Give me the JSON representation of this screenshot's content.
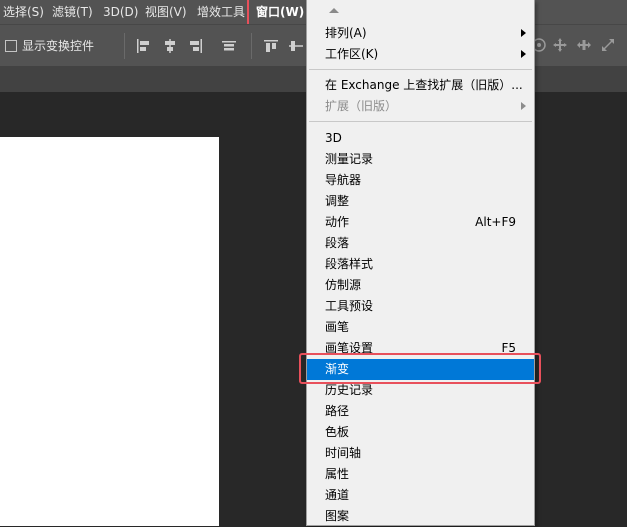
{
  "menubar": {
    "items": [
      {
        "label": "选择(S)"
      },
      {
        "label": "滤镜(T)"
      },
      {
        "label": "3D(D)"
      },
      {
        "label": "视图(V)"
      },
      {
        "label": "增效工具"
      },
      {
        "label": "窗口(W)"
      }
    ]
  },
  "optionsbar": {
    "show_transform_label": "显示变换控件",
    "show_transform_checked": false
  },
  "window_menu": {
    "items": [
      {
        "label": "排列(A)",
        "submenu": true
      },
      {
        "label": "工作区(K)",
        "submenu": true
      },
      {
        "label": "在 Exchange 上查找扩展（旧版）..."
      },
      {
        "label": "扩展（旧版）",
        "submenu": true,
        "disabled": true
      },
      {
        "label": "3D"
      },
      {
        "label": "测量记录"
      },
      {
        "label": "导航器"
      },
      {
        "label": "调整"
      },
      {
        "label": "动作",
        "shortcut": "Alt+F9"
      },
      {
        "label": "段落"
      },
      {
        "label": "段落样式"
      },
      {
        "label": "仿制源"
      },
      {
        "label": "工具预设"
      },
      {
        "label": "画笔"
      },
      {
        "label": "画笔设置",
        "shortcut": "F5"
      },
      {
        "label": "渐变",
        "selected": true
      },
      {
        "label": "历史记录"
      },
      {
        "label": "路径"
      },
      {
        "label": "色板"
      },
      {
        "label": "时间轴"
      },
      {
        "label": "属性"
      },
      {
        "label": "通道"
      },
      {
        "label": "图案"
      }
    ]
  },
  "colors": {
    "accent": "#0078d7",
    "highlight_box": "#e8505b"
  }
}
